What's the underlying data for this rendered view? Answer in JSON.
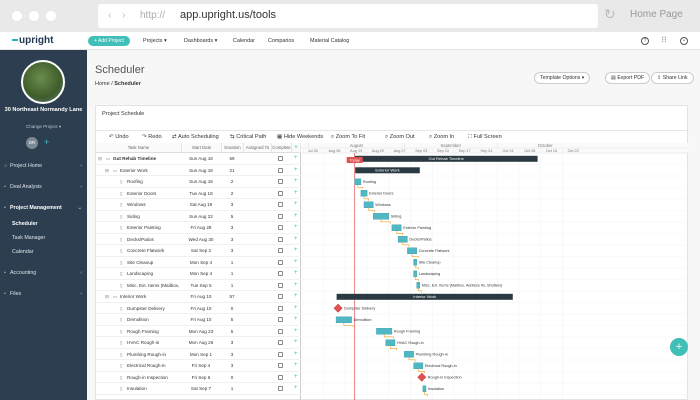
{
  "browser": {
    "proto": "http://",
    "url": "app.upright.us/tools",
    "home_label": "Home Page"
  },
  "topnav": {
    "logo": "upright",
    "add_project": "+ Add Project",
    "menu": [
      "Projects ▾",
      "Dashboards ▾",
      "Calendar",
      "Comparios",
      "Material Catalog"
    ]
  },
  "sidebar": {
    "property_name": "30 Northeast Normandy Lane",
    "change_project": "Change Project ▾",
    "avatar": "DR",
    "items": [
      {
        "label": "Project Home",
        "icon": "house-icon"
      },
      {
        "label": "Deal Analysis",
        "icon": "briefcase-icon"
      },
      {
        "label": "Project Management",
        "icon": "clipboard-icon"
      },
      {
        "label": "Accounting",
        "icon": "ledger-icon"
      },
      {
        "label": "Files",
        "icon": "folder-icon"
      }
    ],
    "subitems": [
      "Scheduler",
      "Task Manager",
      "Calendar"
    ]
  },
  "page": {
    "title": "Scheduler",
    "crumb_home": "Home",
    "crumb_sep": "/",
    "crumb_current": "Scheduler",
    "template_options": "Template Options ▾",
    "export_pdf": "Export PDF",
    "share_link": "Share Link"
  },
  "card": {
    "title": "Project Schedule"
  },
  "toolbar": [
    "Undo",
    "Redo",
    "Auto Scheduling",
    "Critical Path",
    "Hide Weekends",
    "Zoom To Fit",
    "Zoom Out",
    "Zoom In",
    "Full Screen"
  ],
  "grid_headers": [
    "Task Name",
    "Start Date",
    "Duration",
    "Assigned To",
    "Complete"
  ],
  "timeline": {
    "months": [
      "August",
      "September",
      "October"
    ],
    "weeks": [
      "Jul 30",
      "Aug 06",
      "Aug 13",
      "Aug 20",
      "Aug 27",
      "Sep 03",
      "Sep 10",
      "Sep 17",
      "Sep 24",
      "Oct 01",
      "Oct 08",
      "Oct 15",
      "Oct 22"
    ],
    "today_label": "Today"
  },
  "tasks": [
    {
      "name": "Gut Rehab Timeline",
      "start": "Sun Aug 16",
      "dur": "59",
      "level": 0,
      "type": "project",
      "label": "Gut Rehab Timeline"
    },
    {
      "name": "Exterior Work",
      "start": "Sun Aug 16",
      "dur": "21",
      "level": 1,
      "type": "group",
      "label": "Exterior Work"
    },
    {
      "name": "Roofing",
      "start": "Sun Aug 16",
      "dur": "2",
      "level": 2,
      "type": "task",
      "label": "Roofing"
    },
    {
      "name": "Exterior Doors",
      "start": "Tue Aug 18",
      "dur": "2",
      "level": 2,
      "type": "task",
      "label": "Exterior Doors"
    },
    {
      "name": "Windows",
      "start": "Sat Aug 19",
      "dur": "3",
      "level": 2,
      "type": "task",
      "label": "Windows"
    },
    {
      "name": "Siding",
      "start": "Sun Aug 22",
      "dur": "5",
      "level": 2,
      "type": "task",
      "label": "Siding"
    },
    {
      "name": "Exterior Painting",
      "start": "Fri Aug 28",
      "dur": "3",
      "level": 2,
      "type": "task",
      "label": "Exterior Painting"
    },
    {
      "name": "Decks/Patios",
      "start": "Wed Aug 30",
      "dur": "3",
      "level": 2,
      "type": "task",
      "label": "Decks/Patios"
    },
    {
      "name": "Concrete Flatwork",
      "start": "Sat Sep 2",
      "dur": "3",
      "level": 2,
      "type": "task",
      "label": "Concrete Flatwork"
    },
    {
      "name": "Site Cleanup",
      "start": "Mon Sep 4",
      "dur": "1",
      "level": 2,
      "type": "task",
      "label": "Site Cleanup"
    },
    {
      "name": "Landscaping",
      "start": "Mon Sep 4",
      "dur": "1",
      "level": 2,
      "type": "task",
      "label": "Landscaping"
    },
    {
      "name": "Misc. Ext. Items (Mailbox, Address #s, Shutters)",
      "start": "Tue Sep 5",
      "dur": "1",
      "level": 2,
      "type": "task",
      "label": "Misc. Ext. Items (Mailbox, Address #s, Shutters)"
    },
    {
      "name": "Interior Work",
      "start": "Fri Aug 10",
      "dur": "57",
      "level": 1,
      "type": "group",
      "label": "Interior Work"
    },
    {
      "name": "Dumpster Delivery",
      "start": "Fri Aug 10",
      "dur": "0",
      "level": 2,
      "type": "milestone",
      "label": "Dumpster Delivery"
    },
    {
      "name": "Demolition",
      "start": "Fri Aug 10",
      "dur": "5",
      "level": 2,
      "type": "task",
      "label": "Demolition"
    },
    {
      "name": "Rough Framing",
      "start": "Mon Aug 23",
      "dur": "5",
      "level": 2,
      "type": "task",
      "label": "Rough Framing"
    },
    {
      "name": "HVAC Rough-in",
      "start": "Mon Aug 26",
      "dur": "3",
      "level": 2,
      "type": "task",
      "label": "HVAC Rough-in"
    },
    {
      "name": "Plumbing Rough-in",
      "start": "Mon Sep 1",
      "dur": "3",
      "level": 2,
      "type": "task",
      "label": "Plumbing Rough-in"
    },
    {
      "name": "Electrical Rough-in",
      "start": "Fri Sep 4",
      "dur": "3",
      "level": 2,
      "type": "task",
      "label": "Electrical Rough-in"
    },
    {
      "name": "Rough-in Inspection",
      "start": "Fri Sep 6",
      "dur": "0",
      "level": 2,
      "type": "milestone",
      "label": "Rough-in Inspection"
    },
    {
      "name": "Insulation",
      "start": "Sat Sep 7",
      "dur": "1",
      "level": 2,
      "type": "task",
      "label": "Insulation"
    }
  ],
  "colors": {
    "accent": "#3fbfb7",
    "sidebar": "#2c3e50",
    "bar": "#4fb8c4",
    "summary": "#2b3a42",
    "today": "#e05252",
    "milestone": "#e05252",
    "link": "#f0a020"
  }
}
